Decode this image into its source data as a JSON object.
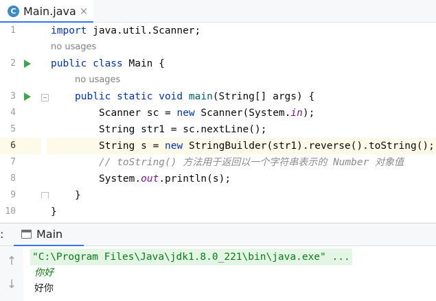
{
  "editor_tab": {
    "icon_letter": "C",
    "title": "Main.java",
    "close": "×"
  },
  "line_numbers": [
    "1",
    "2",
    "3",
    "4",
    "5",
    "6",
    "7",
    "8",
    "9",
    "10"
  ],
  "hints": {
    "class_usages": "no usages",
    "method_usages": "no usages"
  },
  "code": {
    "l1_kw": "import",
    "l1_rest": " java.util.Scanner;",
    "l2_kw": "public class",
    "l2_rest": " Main {",
    "l3_kw": "public static void",
    "l3_method": "main",
    "l3_rest": "(String[] args) {",
    "l4_a": "Scanner sc = ",
    "l4_kw": "new",
    "l4_b": " Scanner(System.",
    "l4_field": "in",
    "l4_c": ");",
    "l5": "String str1 = sc.nextLine();",
    "l6_a": "String s = ",
    "l6_kw": "new",
    "l6_b": " StringBuilder(str1).reverse().toString();",
    "l7_comment_a": "// toString() ",
    "l7_comment_zh": "方法用于返回以一个字符串表示的",
    "l7_comment_b": " Number ",
    "l7_comment_zh2": "对象值",
    "l8_a": "System.",
    "l8_field": "out",
    "l8_b": ".println(s);",
    "l9": "}",
    "l10": "}"
  },
  "run_panel": {
    "prefix": ":",
    "tab_label": "Main",
    "up_arrow": "↑",
    "down_arrow": "↓",
    "command": "\"C:\\Program Files\\Java\\jdk1.8.0_221\\bin\\java.exe\" ...",
    "user_input": "你好",
    "program_output": "好你"
  },
  "colors": {
    "keyword": "#0033b3",
    "method_declaration": "#00627a",
    "static_field": "#871094",
    "comment": "#8c8c8c",
    "run_icon": "#3fa449",
    "current_line": "#fdfae9",
    "console_command": "#067d17"
  },
  "icons": {
    "tab_icon": "java-class-icon",
    "gutter_run": "run-play-icon",
    "fold": "fold-icon",
    "console_tab": "console-icon"
  }
}
